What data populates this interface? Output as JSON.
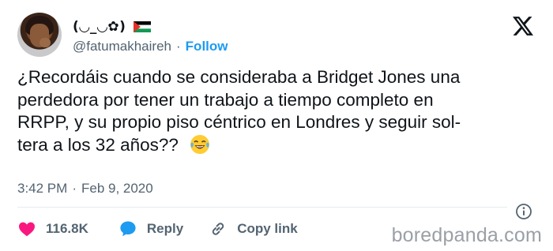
{
  "user": {
    "display_name": "(◡_◡✿)",
    "handle": "@fatumakhaireh",
    "separator": "·",
    "follow_label": "Follow"
  },
  "tweet": {
    "lines": [
      "¿Recordáis cuando se consideraba a Bridget Jones una",
      "perdedora por tener un trabajo a tiempo completo en",
      "RRPP, y su propio piso céntrico en Londres y seguir sol-",
      "tera a los 32 años??"
    ],
    "emoji": "face-with-tears-of-joy"
  },
  "meta": {
    "time": "3:42 PM",
    "separator": "·",
    "date": "Feb 9, 2020"
  },
  "actions": {
    "likes": "116.8K",
    "reply_label": "Reply",
    "copy_label": "Copy link"
  },
  "watermark": "boredpanda.com",
  "colors": {
    "accent": "#1d9bf0",
    "like": "#f91880",
    "reply": "#1d9bf0",
    "text": "#0f1419",
    "muted": "#536471"
  },
  "icons": [
    "palestine-flag-icon",
    "x-logo-icon",
    "info-icon",
    "heart-icon",
    "speech-bubble-icon",
    "link-icon"
  ]
}
